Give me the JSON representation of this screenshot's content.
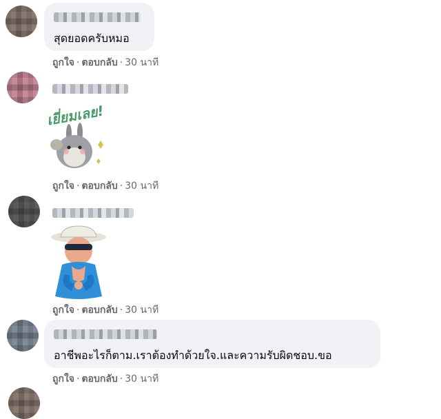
{
  "comments": [
    {
      "text": "สุดยอดครับหมอ",
      "actions": {
        "like": "ถูกใจ",
        "reply": "ตอบกลับ",
        "separator": "·",
        "time": "30 นาที"
      }
    },
    {
      "sticker": {
        "caption": "เยี่ยมเลย!",
        "icon": "bunny-thumbs-sticker"
      },
      "actions": {
        "like": "ถูกใจ",
        "reply": "ตอบกลับ",
        "separator": "·",
        "time": "30 นาที"
      }
    },
    {
      "sticker": {
        "icon": "old-man-sunglasses-sticker"
      },
      "actions": {
        "like": "ถูกใจ",
        "reply": "ตอบกลับ",
        "separator": "·",
        "time": "30 นาที"
      }
    },
    {
      "text": "อาชีพอะไรก็ตาม.เราต้องทำด้วยใจ.และความรับผิดชอบ.ขอ",
      "actions": {
        "like": "ถูกใจ",
        "reply": "ตอบกลับ",
        "separator": "·",
        "time": "30 นาที"
      }
    }
  ],
  "colors": {
    "bubble": "#f0f2f5",
    "meta": "#65676b",
    "text": "#050505"
  }
}
